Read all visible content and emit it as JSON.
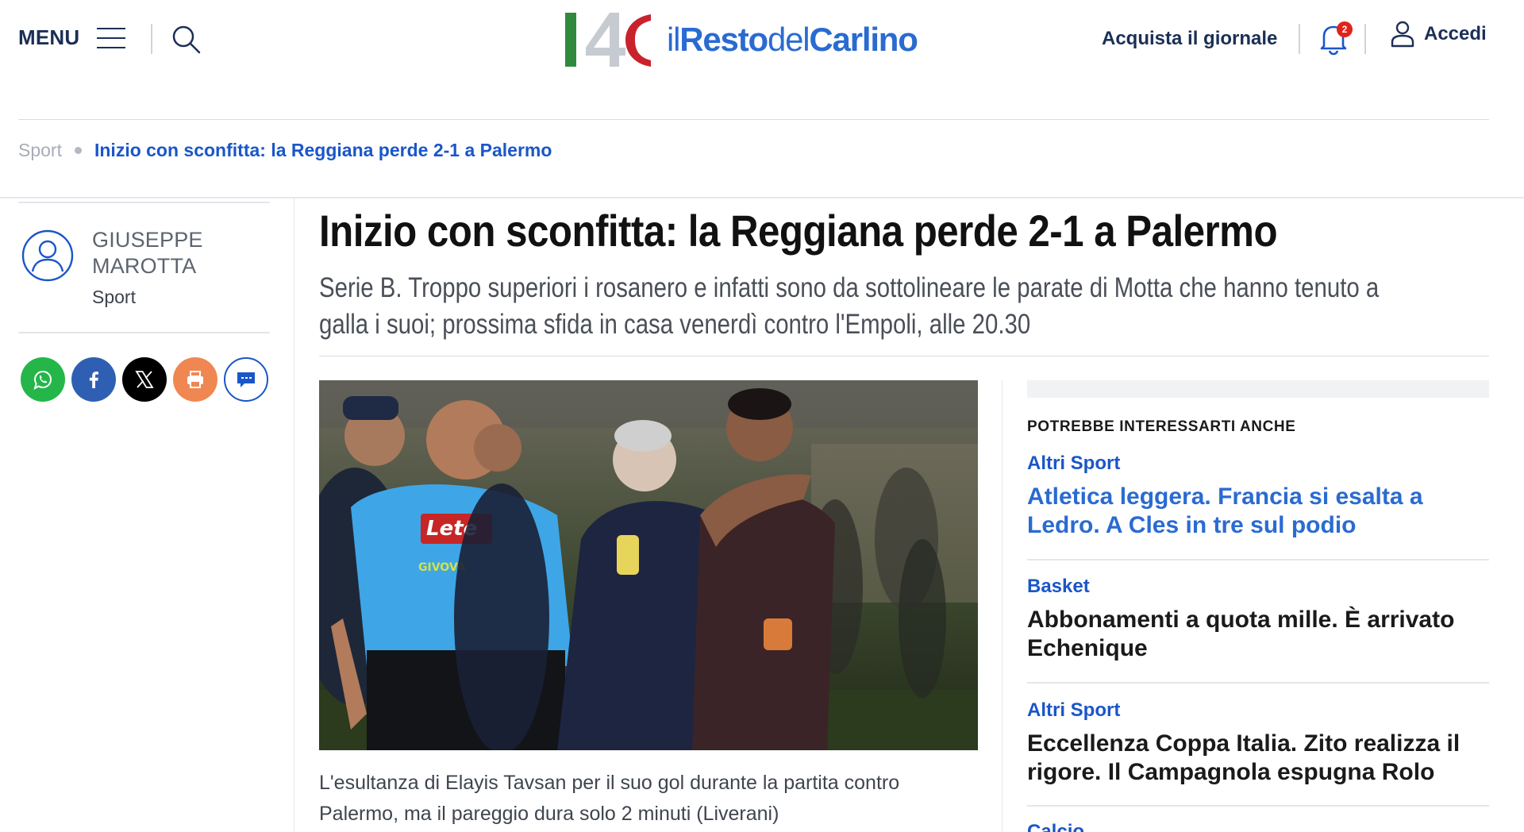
{
  "header": {
    "menu_label": "MENU",
    "logo": {
      "mark_text": "140",
      "word_il": "il",
      "word_resto": "Resto",
      "word_del": "del",
      "word_carlino": "Carlino",
      "colors": {
        "green": "#2f8a3e",
        "gray": "#c6cbd1",
        "red": "#c8232c",
        "blue": "#2a6bd1"
      }
    },
    "buy_label": "Acquista il giornale",
    "notifications_count": "2",
    "login_label": "Accedi"
  },
  "breadcrumb": {
    "section": "Sport",
    "current": "Inizio con sconfitta: la Reggiana perde 2-1 a Palermo"
  },
  "author": {
    "name": "GIUSEPPE MAROTTA",
    "section": "Sport"
  },
  "share_icons": [
    "whatsapp-icon",
    "facebook-icon",
    "x-icon",
    "print-icon",
    "comments-icon"
  ],
  "article": {
    "title": "Inizio con sconfitta: la Reggiana perde 2-1 a Palermo",
    "subtitle": "Serie B. Troppo superiori i rosanero e infatti sono da sottolineare le parate di Motta che hanno tenuto a galla i suoi; prossima sfida in casa venerdì contro l'Empoli, alle 20.30",
    "caption": "L'esultanza di Elayis Tavsan per il suo gol durante la partita contro Palermo, ma il pareggio dura solo 2 minuti (Liverani)"
  },
  "related": {
    "heading": "POTREBBE INTERESSARTI ANCHE",
    "items": [
      {
        "category": "Altri Sport",
        "headline": "Atletica leggera. Francia si esalta a Ledro. A Cles in tre sul podio",
        "headline_color": "#2a6bd1"
      },
      {
        "category": "Basket",
        "headline": "Abbonamenti a quota mille. È arrivato Echenique",
        "headline_color": "#1a1a1a"
      },
      {
        "category": "Altri Sport",
        "headline": "Eccellenza Coppa Italia. Zito realizza il rigore. Il Campagnola espugna Rolo",
        "headline_color": "#1a1a1a"
      },
      {
        "category": "Calcio"
      }
    ]
  },
  "colors": {
    "navy": "#1b2f56",
    "link_blue": "#1a56c8",
    "whatsapp": "#25b64a",
    "facebook": "#2f5fb3",
    "x": "#000000",
    "print": "#f08752",
    "comments_ring": "#1a56c8"
  }
}
